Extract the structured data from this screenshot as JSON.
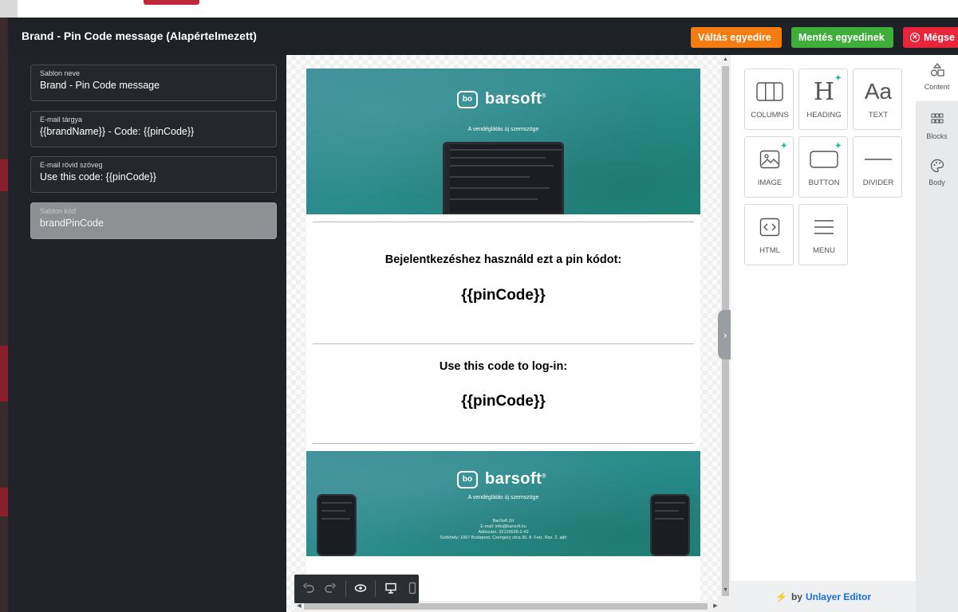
{
  "header": {
    "title": "Brand - Pin Code message (Alapértelmezett)",
    "switch_label": "Váltás egyedire",
    "save_label": "Mentés egyedinek",
    "cancel_label": "Mégse"
  },
  "fields": [
    {
      "label": "Sablon neve",
      "value": "Brand - Pin Code message"
    },
    {
      "label": "E-mail tárgya",
      "value": "{{brandName}} - Code: {{pinCode}}"
    },
    {
      "label": "E-mail rövid szöveg",
      "value": "Use this code: {{pinCode}}"
    },
    {
      "label": "Sablon kód",
      "value": "brandPinCode"
    }
  ],
  "email": {
    "logo_mark": "bo",
    "logo_text": "barsoft",
    "tagline": "A vendéglátás új szemszöge",
    "hu_instruction": "Bejelentkezéshez használd ezt a pin kódot:",
    "pin_placeholder_1": "{{pinCode}}",
    "en_instruction": "Use this code to log-in:",
    "pin_placeholder_2": "{{pinCode}}",
    "footer": {
      "company": "BarSoft Zrt",
      "email": "E-mail: info@barsoft.hu",
      "tax": "Adószám: 32129536-2-42",
      "address": "Székhely: 1067 Budapest, Csengery utca 30. 8. Felz. Rsz. 2. ajtó"
    }
  },
  "toolbar": {
    "undo_icon": "undo-icon",
    "redo_icon": "redo-icon",
    "preview_icon": "eye-icon",
    "desktop_icon": "desktop-icon",
    "mobile_icon": "mobile-icon"
  },
  "tools": {
    "tiles": [
      {
        "label": "COLUMNS",
        "icon": "columns-icon"
      },
      {
        "label": "HEADING",
        "icon": "heading-icon"
      },
      {
        "label": "TEXT",
        "icon": "text-icon"
      },
      {
        "label": "IMAGE",
        "icon": "image-icon"
      },
      {
        "label": "BUTTON",
        "icon": "button-icon"
      },
      {
        "label": "DIVIDER",
        "icon": "divider-icon"
      },
      {
        "label": "HTML",
        "icon": "html-icon"
      },
      {
        "label": "MENU",
        "icon": "menu-icon"
      }
    ],
    "footer_prefix": "by",
    "footer_brand": "Unlayer Editor"
  },
  "rail": [
    {
      "label": "Content",
      "icon": "shapes-icon"
    },
    {
      "label": "Blocks",
      "icon": "blocks-icon"
    },
    {
      "label": "Body",
      "icon": "palette-icon"
    }
  ],
  "colors": {
    "switch": "#f57c10",
    "save": "#3fae3b",
    "cancel": "#e8253a",
    "banner": "#2d8c8d",
    "accent_link": "#1c6fd6"
  }
}
